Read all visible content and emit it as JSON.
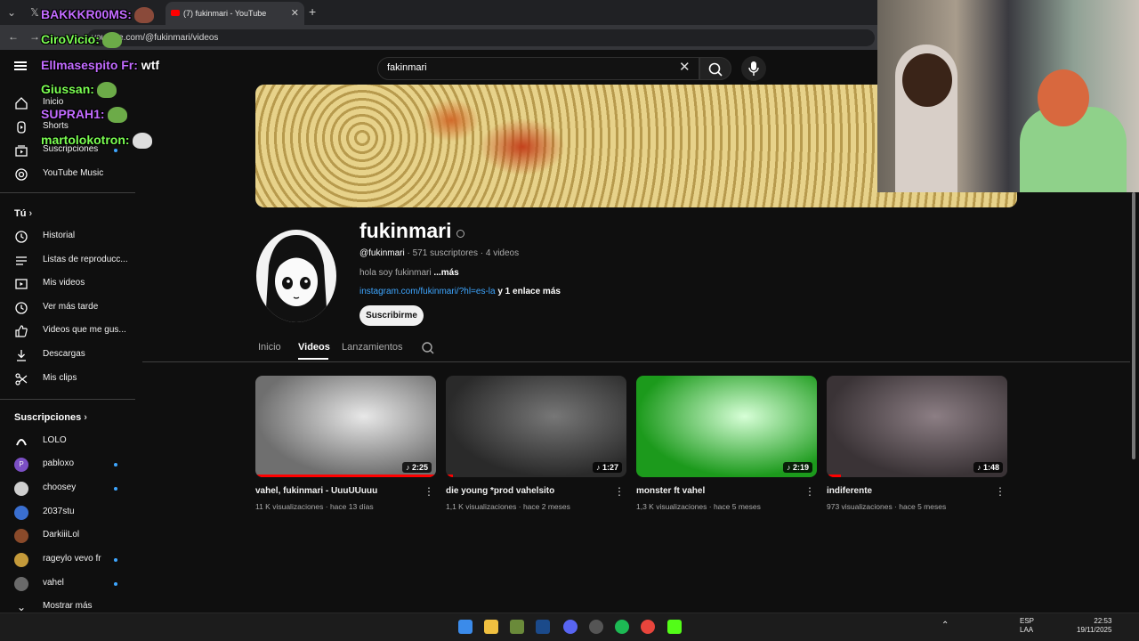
{
  "browser": {
    "tab_title": "(7) fukinmari - YouTube",
    "url": "youtube.com/@fukinmari/videos"
  },
  "header": {
    "search_value": "fakinmari"
  },
  "sidebar": {
    "main": [
      {
        "label": "Inicio",
        "icon": "home-icon"
      },
      {
        "label": "Shorts",
        "icon": "shorts-icon"
      },
      {
        "label": "Suscripciones",
        "icon": "subscriptions-icon"
      },
      {
        "label": "YouTube Music",
        "icon": "music-icon"
      }
    ],
    "you_heading": "Tú",
    "you": [
      {
        "label": "Historial",
        "icon": "history-icon"
      },
      {
        "label": "Listas de reproducc...",
        "icon": "playlists-icon"
      },
      {
        "label": "Mis videos",
        "icon": "my-videos-icon"
      },
      {
        "label": "Ver más tarde",
        "icon": "watch-later-icon"
      },
      {
        "label": "Videos que me gus...",
        "icon": "liked-icon"
      },
      {
        "label": "Descargas",
        "icon": "downloads-icon"
      },
      {
        "label": "Mis clips",
        "icon": "clips-icon"
      }
    ],
    "subs_heading": "Suscripciones",
    "subs": [
      {
        "label": "LOLO",
        "color": "#222222",
        "dot": false
      },
      {
        "label": "pabloxo",
        "color": "#7b4fc4",
        "dot": true
      },
      {
        "label": "choosey",
        "color": "#cfcfcf",
        "dot": true
      },
      {
        "label": "2037stu",
        "color": "#3a6fd0",
        "dot": false
      },
      {
        "label": "DarkiiiLol",
        "color": "#8a4a2a",
        "dot": false
      },
      {
        "label": "rageylo vevo fr",
        "color": "#c49a3a",
        "dot": true
      },
      {
        "label": "vahel",
        "color": "#6a6a6a",
        "dot": true
      }
    ],
    "show_more": "Mostrar más"
  },
  "channel": {
    "name": "fukinmari",
    "handle": "@fukinmari",
    "meta": " · 571 suscriptores · 4 videos",
    "description": "hola soy fukinmari",
    "more": "...más",
    "link": "instagram.com/fukinmari/?hl=es-la",
    "link_more": " y 1 enlace más",
    "subscribe": "Suscribirme",
    "tabs": [
      "Inicio",
      "Videos",
      "Lanzamientos"
    ]
  },
  "videos": [
    {
      "title": "vahel, fukinmari - UuuUUuuu",
      "views": "11 K visualizaciones",
      "age": "hace 13 días",
      "duration": "2:25",
      "watched": 1.0,
      "colors": [
        "#6f6f6f",
        "#e8e8e8"
      ]
    },
    {
      "title": "die young *prod vahelsito",
      "views": "1,1 K visualizaciones",
      "age": "hace 2 meses",
      "duration": "1:27",
      "watched": 0.04,
      "colors": [
        "#2a2a2a",
        "#777777"
      ]
    },
    {
      "title": "monster ft vahel",
      "views": "1,3 K visualizaciones",
      "age": "hace 5 meses",
      "duration": "2:19",
      "watched": 0.0,
      "colors": [
        "#1c9a1c",
        "#d7ffd7"
      ]
    },
    {
      "title": "indiferente",
      "views": "973 visualizaciones",
      "age": "hace 5 meses",
      "duration": "1:48",
      "watched": 0.08,
      "colors": [
        "#3a3336",
        "#8c7e84"
      ]
    }
  ],
  "chat": [
    {
      "user": "BAKKKR00MS:",
      "msg": "",
      "color": "#c26bff"
    },
    {
      "user": "CiroVicio:",
      "msg": "",
      "color": "#7bff52"
    },
    {
      "user": "Ellmasespito Fr:",
      "msg": " wtf",
      "color": "#c26bff"
    },
    {
      "user": "Giussan:",
      "msg": "",
      "color": "#7bff52"
    },
    {
      "user": "SUPRAH1:",
      "msg": "",
      "color": "#c26bff"
    },
    {
      "user": "martolokotron:",
      "msg": "",
      "color": "#7bff52"
    }
  ],
  "tray": {
    "lang1": "ESP",
    "lang2": "LAA",
    "time": "22:53",
    "date": "19/11/2025"
  }
}
